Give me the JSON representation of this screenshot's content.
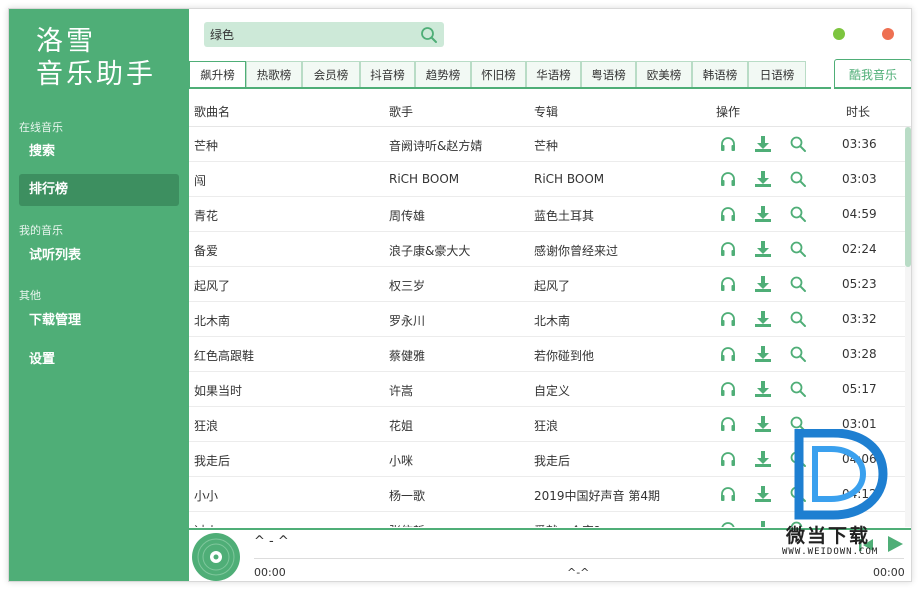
{
  "app": {
    "logo_line1": "洛雪",
    "logo_line2": "音乐助手",
    "accent": "#4fae77"
  },
  "sidebar": {
    "sections": [
      {
        "title": "在线音乐",
        "items": [
          {
            "label": "搜索"
          },
          {
            "label": "排行榜"
          }
        ]
      },
      {
        "title": "我的音乐",
        "items": [
          {
            "label": "试听列表"
          }
        ]
      },
      {
        "title": "其他",
        "items": [
          {
            "label": "下载管理"
          },
          {
            "label": "设置"
          }
        ]
      }
    ],
    "active": "排行榜"
  },
  "search": {
    "value": "绿色",
    "icon": "search-icon"
  },
  "window_controls": {
    "minimize_color": "#7dc53f",
    "close_color": "#ee7052"
  },
  "tabs": [
    "飙升榜",
    "热歌榜",
    "会员榜",
    "抖音榜",
    "趋势榜",
    "怀旧榜",
    "华语榜",
    "粤语榜",
    "欧美榜",
    "韩语榜",
    "日语榜"
  ],
  "active_tab": "飙升榜",
  "source_label": "酷我音乐",
  "table": {
    "headers": {
      "name": "歌曲名",
      "artist": "歌手",
      "album": "专辑",
      "actions": "操作",
      "duration": "时长"
    },
    "rows": [
      {
        "name": "芒种",
        "artist": "音阙诗听&赵方婧",
        "album": "芒种",
        "duration": "03:36"
      },
      {
        "name": "闯",
        "artist": "RiCH BOOM",
        "album": "RiCH BOOM",
        "duration": "03:03"
      },
      {
        "name": "青花",
        "artist": "周传雄",
        "album": "蓝色土耳其",
        "duration": "04:59"
      },
      {
        "name": "备爱",
        "artist": "浪子康&豪大大",
        "album": "感谢你曾经来过",
        "duration": "02:24"
      },
      {
        "name": "起风了",
        "artist": "权三岁",
        "album": "起风了",
        "duration": "05:23"
      },
      {
        "name": "北木南",
        "artist": "罗永川",
        "album": "北木南",
        "duration": "03:32"
      },
      {
        "name": "红色高跟鞋",
        "artist": "蔡健雅",
        "album": "若你碰到他",
        "duration": "03:28"
      },
      {
        "name": "如果当时",
        "artist": "许嵩",
        "album": "自定义",
        "duration": "05:17"
      },
      {
        "name": "狂浪",
        "artist": "花姐",
        "album": "狂浪",
        "duration": "03:01"
      },
      {
        "name": "我走后",
        "artist": "小咪",
        "album": "我走后",
        "duration": "04:06"
      },
      {
        "name": "小小",
        "artist": "杨一歌",
        "album": "2019中国好声音 第4期",
        "duration": "04:12"
      },
      {
        "name": "过火",
        "artist": "张信哲",
        "album": "爱就一个字?",
        "duration": ""
      }
    ]
  },
  "player": {
    "title": "^ - ^",
    "current_time": "00:00",
    "lyric": "^-^",
    "total_time": "00:00"
  },
  "watermark": {
    "text": "微当下载",
    "url": "WWW.WEIDOWN.COM"
  }
}
